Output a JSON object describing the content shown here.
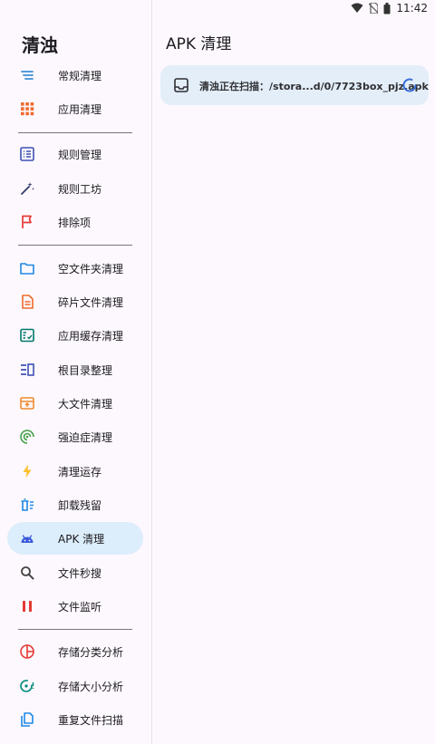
{
  "status_bar": {
    "time": "11:42",
    "left_icon": "A"
  },
  "sidebar": {
    "title": "清浊",
    "groups": [
      [
        {
          "label": "常规清理",
          "icon": "sweep-icon",
          "color": "#3b8ed8"
        },
        {
          "label": "应用清理",
          "icon": "apps-grid-icon",
          "color": "#ef6a2e"
        }
      ],
      [
        {
          "label": "规则管理",
          "icon": "list-box-icon",
          "color": "#3f51b5"
        },
        {
          "label": "规则工坊",
          "icon": "magic-wand-icon",
          "color": "#2f3a70"
        },
        {
          "label": "排除项",
          "icon": "flag-icon",
          "color": "#e53935"
        }
      ],
      [
        {
          "label": "空文件夹清理",
          "icon": "folder-icon",
          "color": "#1e88e5"
        },
        {
          "label": "碎片文件清理",
          "icon": "document-icon",
          "color": "#ef6a2e"
        },
        {
          "label": "应用缓存清理",
          "icon": "checklist-icon",
          "color": "#00796b"
        },
        {
          "label": "根目录整理",
          "icon": "columns-icon",
          "color": "#3f51b5"
        },
        {
          "label": "大文件清理",
          "icon": "archive-icon",
          "color": "#ef8a2e"
        },
        {
          "label": "强迫症清理",
          "icon": "radar-icon",
          "color": "#43a047"
        },
        {
          "label": "清理运存",
          "icon": "lightning-icon",
          "color": "#fbc02d"
        },
        {
          "label": "卸载残留",
          "icon": "trash-list-icon",
          "color": "#1e88e5"
        },
        {
          "label": "APK 清理",
          "icon": "android-icon",
          "color": "#3b5bdb"
        },
        {
          "label": "文件秒搜",
          "icon": "search-icon",
          "color": "#444444"
        },
        {
          "label": "文件监听",
          "icon": "pause-icon",
          "color": "#e53935"
        }
      ],
      [
        {
          "label": "存储分类分析",
          "icon": "pie-chart-icon",
          "color": "#e53935"
        },
        {
          "label": "存储大小分析",
          "icon": "target-icon",
          "color": "#00897b"
        },
        {
          "label": "重复文件扫描",
          "icon": "copy-icon",
          "color": "#1e88e5"
        }
      ]
    ],
    "active_label": "APK 清理"
  },
  "main": {
    "title": "APK 清理",
    "scan_card": {
      "text": "清浊正在扫描：/stora...d/0/7723box_pjz.apk",
      "icon": "inbox-icon",
      "spinner": "loading-spinner-icon",
      "accent": "#3b6fd8"
    }
  }
}
